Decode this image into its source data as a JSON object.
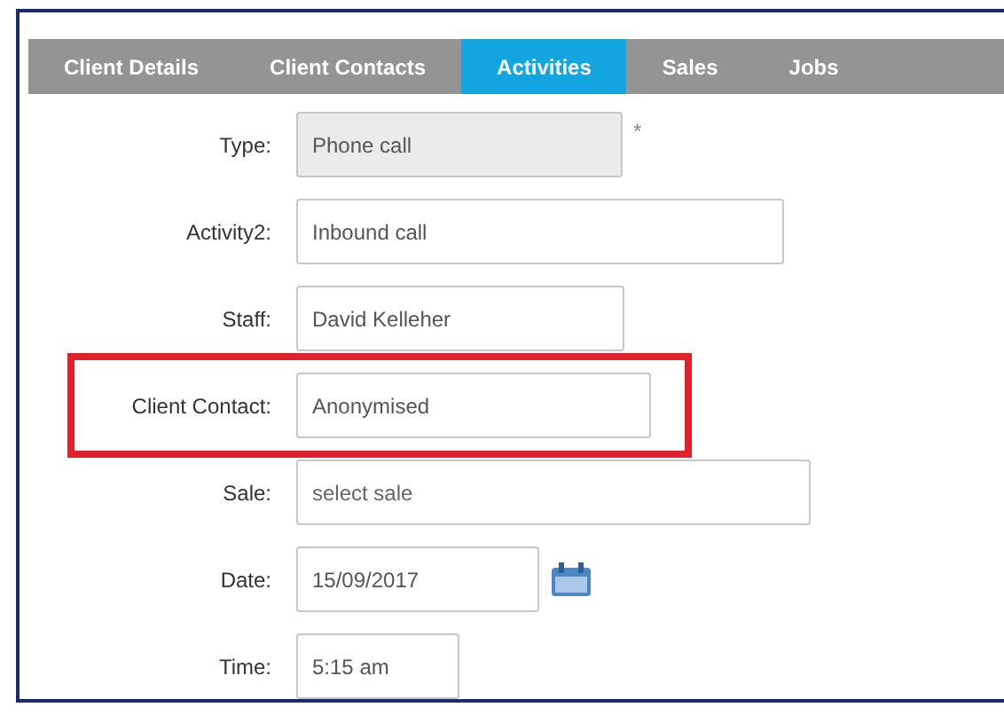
{
  "tabs": [
    {
      "label": "Client Details",
      "selected": false
    },
    {
      "label": "Client Contacts",
      "selected": false
    },
    {
      "label": "Activities",
      "selected": true
    },
    {
      "label": "Sales",
      "selected": false
    },
    {
      "label": "Jobs",
      "selected": false
    }
  ],
  "fields": [
    {
      "label": "Type:",
      "value": "Phone call",
      "disabled": true,
      "required_mark": "*",
      "highlighted": false
    },
    {
      "label": "Activity2:",
      "value": "Inbound call",
      "disabled": false,
      "highlighted": false
    },
    {
      "label": "Staff:",
      "value": "David Kelleher",
      "disabled": false,
      "highlighted": false
    },
    {
      "label": "Client Contact:",
      "value": "Anonymised",
      "disabled": false,
      "highlighted": true
    },
    {
      "label": "Sale:",
      "placeholder": "select sale",
      "disabled": false,
      "highlighted": false
    },
    {
      "label": "Date:",
      "value": "15/09/2017",
      "disabled": false,
      "highlighted": false,
      "calendar": true
    },
    {
      "label": "Time:",
      "value": "5:15 am",
      "disabled": false,
      "highlighted": false
    }
  ]
}
